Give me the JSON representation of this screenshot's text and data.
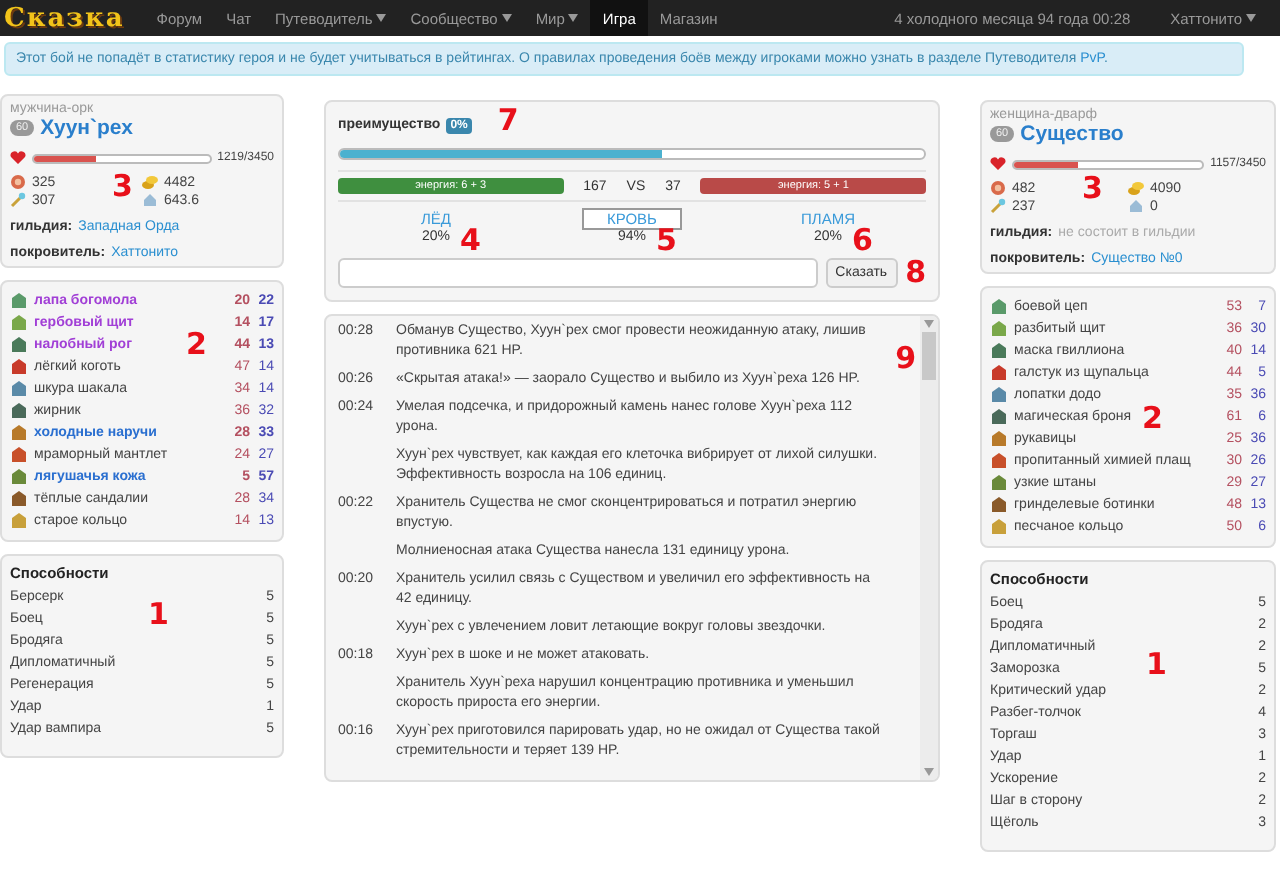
{
  "nav": {
    "logo": "Сказка",
    "items": [
      {
        "label": "Форум",
        "dropdown": false,
        "selected": false
      },
      {
        "label": "Чат",
        "dropdown": false,
        "selected": false
      },
      {
        "label": "Путеводитель",
        "dropdown": true,
        "selected": false
      },
      {
        "label": "Сообщество",
        "dropdown": true,
        "selected": false
      },
      {
        "label": "Мир",
        "dropdown": true,
        "selected": false
      },
      {
        "label": "Игра",
        "dropdown": false,
        "selected": true
      },
      {
        "label": "Магазин",
        "dropdown": false,
        "selected": false
      }
    ],
    "date": "4 холодного месяца 94 года 00:28",
    "user": {
      "label": "Хаттонито",
      "dropdown": true
    }
  },
  "notice": {
    "text": "Этот бой не попадёт в статистику героя и не будет учитываться в рейтингах. О правилах проведения боёв между игроками можно узнать в разделе Путеводителя ",
    "link": "PvP",
    "end": "."
  },
  "heroes": [
    {
      "race": "мужчина-орк",
      "level": "60",
      "name": "Хуун`рех",
      "hp": {
        "level": 0.353,
        "reading": "1219/3450"
      },
      "stats": [
        "325",
        "307",
        "4482",
        "643.6"
      ],
      "guild": {
        "label": "гильдия:",
        "value": "Западная Орда",
        "member": true
      },
      "patron": {
        "label": "покровитель:",
        "value": "Хаттонито"
      },
      "mark": "3",
      "equipment": {
        "mark": "2",
        "items": [
          {
            "name": "лапа богомола",
            "kind": "epic",
            "a": "20",
            "b": "22"
          },
          {
            "name": "гербовый щит",
            "kind": "epic",
            "a": "14",
            "b": "17"
          },
          {
            "name": "налобный рог",
            "kind": "epic",
            "a": "44",
            "b": "13"
          },
          {
            "name": "лёгкий коготь",
            "kind": "common",
            "a": "47",
            "b": "14"
          },
          {
            "name": "шкура шакала",
            "kind": "common",
            "a": "34",
            "b": "14"
          },
          {
            "name": "жирник",
            "kind": "common",
            "a": "36",
            "b": "32"
          },
          {
            "name": "холодные наручи",
            "kind": "rare",
            "a": "28",
            "b": "33"
          },
          {
            "name": "мраморный мантлет",
            "kind": "common",
            "a": "24",
            "b": "27"
          },
          {
            "name": "лягушачья кожа",
            "kind": "rare",
            "a": "5",
            "b": "57"
          },
          {
            "name": "тёплые сандалии",
            "kind": "common",
            "a": "28",
            "b": "34"
          },
          {
            "name": "старое кольцо",
            "kind": "common",
            "a": "14",
            "b": "13"
          }
        ]
      },
      "abilities": {
        "title": "Способности",
        "mark": "1",
        "items": [
          {
            "name": "Берсерк",
            "value": "5"
          },
          {
            "name": "Боец",
            "value": "5"
          },
          {
            "name": "Бродяга",
            "value": "5"
          },
          {
            "name": "Дипломатичный",
            "value": "5"
          },
          {
            "name": "Регенерация",
            "value": "5"
          },
          {
            "name": "Удар",
            "value": "1"
          },
          {
            "name": "Удар вампира",
            "value": "5"
          }
        ]
      }
    },
    {
      "race": "женщина-дварф",
      "level": "60",
      "name": "Существо",
      "hp": {
        "level": 0.335,
        "reading": "1157/3450"
      },
      "stats": [
        "482",
        "237",
        "4090",
        "0"
      ],
      "guild": {
        "label": "гильдия:",
        "value": "не состоит в гильдии",
        "member": false
      },
      "patron": {
        "label": "покровитель:",
        "value": "Существо №0"
      },
      "mark": "3",
      "equipment": {
        "mark": "2",
        "items": [
          {
            "name": "боевой цеп",
            "kind": "common",
            "a": "53",
            "b": "7"
          },
          {
            "name": "разбитый щит",
            "kind": "common",
            "a": "36",
            "b": "30"
          },
          {
            "name": "маска гвиллиона",
            "kind": "common",
            "a": "40",
            "b": "14"
          },
          {
            "name": "галстук из щупальца",
            "kind": "common",
            "a": "44",
            "b": "5"
          },
          {
            "name": "лопатки додо",
            "kind": "common",
            "a": "35",
            "b": "36"
          },
          {
            "name": "магическая броня",
            "kind": "common",
            "a": "61",
            "b": "6"
          },
          {
            "name": "рукавицы",
            "kind": "common",
            "a": "25",
            "b": "36"
          },
          {
            "name": "пропитанный химией плащ",
            "kind": "common",
            "a": "30",
            "b": "26"
          },
          {
            "name": "узкие штаны",
            "kind": "common",
            "a": "29",
            "b": "27"
          },
          {
            "name": "гринделевые ботинки",
            "kind": "common",
            "a": "48",
            "b": "13"
          },
          {
            "name": "песчаное кольцо",
            "kind": "common",
            "a": "50",
            "b": "6"
          }
        ]
      },
      "abilities": {
        "title": "Способности",
        "mark": "1",
        "items": [
          {
            "name": "Боец",
            "value": "5"
          },
          {
            "name": "Бродяга",
            "value": "2"
          },
          {
            "name": "Дипломатичный",
            "value": "2"
          },
          {
            "name": "Заморозка",
            "value": "5"
          },
          {
            "name": "Критический удар",
            "value": "2"
          },
          {
            "name": "Разбег-толчок",
            "value": "4"
          },
          {
            "name": "Торгаш",
            "value": "3"
          },
          {
            "name": "Удар",
            "value": "1"
          },
          {
            "name": "Ускорение",
            "value": "2"
          },
          {
            "name": "Шаг в сторону",
            "value": "2"
          },
          {
            "name": "Щёголь",
            "value": "3"
          }
        ]
      }
    }
  ],
  "battle": {
    "advantage": {
      "label": "преимущество",
      "badge": "0%",
      "level": 0.55,
      "mark": "7"
    },
    "energy": [
      {
        "label": "энергия: 6 + 3",
        "color": "#3f8f3f"
      },
      {
        "label": "энергия: 5 + 1",
        "color": "#b94a48"
      }
    ],
    "score": [
      "167",
      "VS",
      "37"
    ],
    "elements": [
      {
        "name": "ЛЁД",
        "value": "20%",
        "selected": false,
        "mark": "4"
      },
      {
        "name": "КРОВЬ",
        "value": "94%",
        "selected": true,
        "mark": "5"
      },
      {
        "name": "ПЛАМЯ",
        "value": "20%",
        "selected": false,
        "mark": "6"
      }
    ],
    "say": {
      "button": "Сказать",
      "mark": "8"
    }
  },
  "log": {
    "mark": "9",
    "entries": [
      {
        "time": "00:28",
        "text": "Обманув Существо, Хуун`рех смог провести неожиданную атаку, лишив противника 621 HP."
      },
      {
        "time": "00:26",
        "text": "«Скрытая атака!» — заорало Существо и выбило из Хуун`реха 126 HP."
      },
      {
        "time": "00:24",
        "text": "Умелая подсечка, и придорожный камень нанес голове Хуун`реха 112 урона."
      },
      {
        "text": "Хуун`рех чувствует, как каждая его клеточка вибрирует от лихой силушки. Эффективность возросла на 106 единиц."
      },
      {
        "time": "00:22",
        "text": "Хранитель Существа не смог сконцентрироваться и потратил энергию впустую."
      },
      {
        "text": "Молниеносная атака Существа нанесла 131 единицу урона."
      },
      {
        "time": "00:20",
        "text": "Хранитель усилил связь с Существом и увеличил его эффективность на 42 единицу."
      },
      {
        "text": "Хуун`рех с увлечением ловит летающие вокруг головы звездочки."
      },
      {
        "time": "00:18",
        "text": "Хуун`рех в шоке и не может атаковать."
      },
      {
        "text": "Хранитель Хуун`реха нарушил концентрацию противника и уменьшил скорость прироста его энергии."
      },
      {
        "time": "00:16",
        "text": "Хуун`рех приготовился парировать удар, но не ожидал от Существа такой стремительности и теряет 139 HP."
      }
    ]
  }
}
